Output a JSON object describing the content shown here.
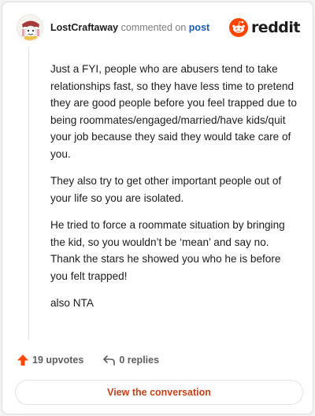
{
  "comment": {
    "author": "LostCraftaway",
    "action_text": "commented on",
    "post_link": "post",
    "brand": "reddit",
    "paragraphs": [
      "Just a FYI, people who are abusers tend to take relationships fast, so they have less time to pretend they are good people before you feel trapped due to being roommates/engaged/married/have kids/quit your job because they said they would take care of you.",
      "They also try to get other important people out of your life so you are isolated.",
      "He tried to force a roommate situation by bringing the kid, so you wouldn’t be ‘mean’ and say no. Thank the stars he showed you who he is before you felt trapped!",
      "also NTA"
    ]
  },
  "actions": {
    "upvotes": "19 upvotes",
    "replies": "0 replies"
  },
  "cta": "View the conversation",
  "colors": {
    "brand_orange": "#ff4500",
    "upvote_orange": "#ff4500",
    "link_blue": "#1a5db6",
    "cta_text": "#c4421a"
  }
}
